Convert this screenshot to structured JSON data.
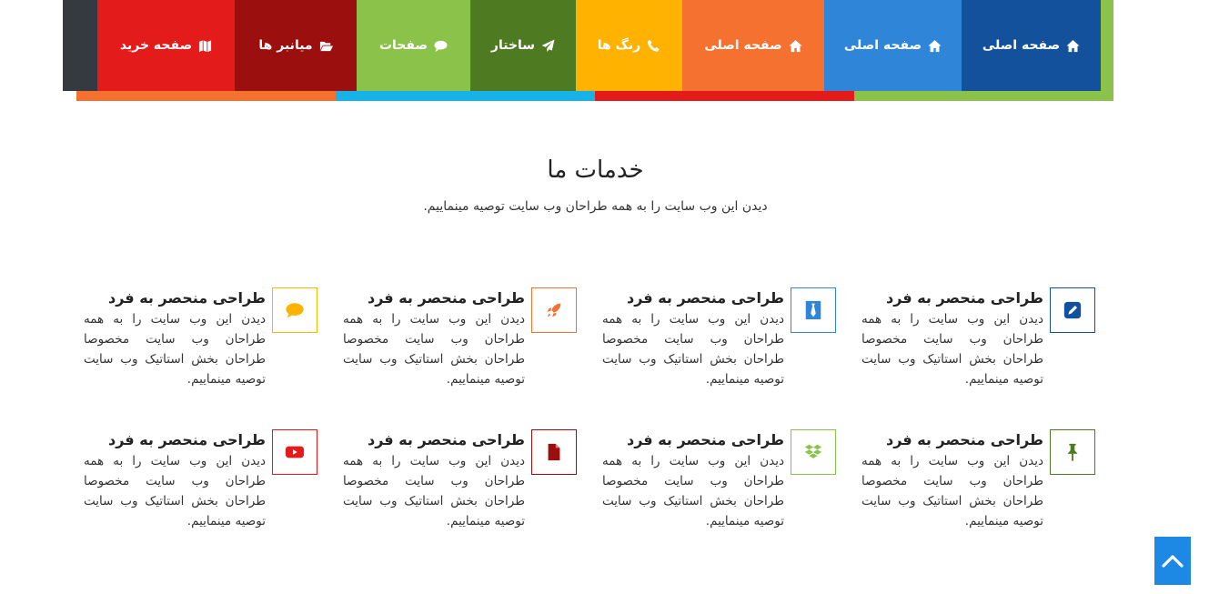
{
  "nav": {
    "items": [
      {
        "label": "صفحه خرید",
        "icon": "map-icon",
        "color": "#e31b1b",
        "width": 151
      },
      {
        "label": "میانبر ها",
        "icon": "folder-open-icon",
        "color": "#9b0f0f",
        "width": 134
      },
      {
        "label": "صفحات",
        "icon": "comment-icon",
        "color": "#8bc34a",
        "width": 125
      },
      {
        "label": "ساختار",
        "icon": "paper-plane-icon",
        "color": "#4e7a22",
        "width": 116
      },
      {
        "label": "رنگ ها",
        "icon": "phone-icon",
        "color": "#ffb300",
        "width": 117
      },
      {
        "label": "صفحه اصلی",
        "icon": "home-icon",
        "color": "#f47130",
        "width": 156
      },
      {
        "label": "صفحه اصلی",
        "icon": "home-icon",
        "color": "#2f86d8",
        "width": 151
      },
      {
        "label": "صفحه اصلی",
        "icon": "home-icon",
        "color": "#13519c",
        "width": 153
      }
    ],
    "color_bar": [
      "#f47130",
      "#17b3e8",
      "#e31b1b",
      "#8bc34a"
    ]
  },
  "section": {
    "title": "خدمات ما",
    "subtitle": "دیدن این وب سایت را به همه طراحان وب سایت توصیه مینماییم."
  },
  "features": [
    {
      "title": "طراحی منحصر به فرد",
      "desc": "دیدن این وب سایت را به همه طراحان وب سایت مخصوصا طراحان بخش استاتیک وب سایت توصیه مینماییم.",
      "icon": "pencil-square-icon",
      "color": "#13519c"
    },
    {
      "title": "طراحی منحصر به فرد",
      "desc": "دیدن این وب سایت را به همه طراحان وب سایت مخصوصا طراحان بخش استاتیک وب سایت توصیه مینماییم.",
      "icon": "tie-icon",
      "color": "#2f86d8"
    },
    {
      "title": "طراحی منحصر به فرد",
      "desc": "دیدن این وب سایت را به همه طراحان وب سایت مخصوصا طراحان بخش استاتیک وب سایت توصیه مینماییم.",
      "icon": "rocket-icon",
      "color": "#f47130"
    },
    {
      "title": "طراحی منحصر به فرد",
      "desc": "دیدن این وب سایت را به همه طراحان وب سایت مخصوصا طراحان بخش استاتیک وب سایت توصیه مینماییم.",
      "icon": "comment-icon",
      "color": "#ffb300"
    },
    {
      "title": "طراحی منحصر به فرد",
      "desc": "دیدن این وب سایت را به همه طراحان وب سایت مخصوصا طراحان بخش استاتیک وب سایت توصیه مینماییم.",
      "icon": "thumb-tack-icon",
      "color": "#4e7a22"
    },
    {
      "title": "طراحی منحصر به فرد",
      "desc": "دیدن این وب سایت را به همه طراحان وب سایت مخصوصا طراحان بخش استاتیک وب سایت توصیه مینماییم.",
      "icon": "dropbox-icon",
      "color": "#8bc34a"
    },
    {
      "title": "طراحی منحصر به فرد",
      "desc": "دیدن این وب سایت را به همه طراحان وب سایت مخصوصا طراحان بخش استاتیک وب سایت توصیه مینماییم.",
      "icon": "file-icon",
      "color": "#9b0f0f"
    },
    {
      "title": "طراحی منحصر به فرد",
      "desc": "دیدن این وب سایت را به همه طراحان وب سایت مخصوصا طراحان بخش استاتیک وب سایت توصیه مینماییم.",
      "icon": "youtube-icon",
      "color": "#e31b1b"
    }
  ],
  "scroll_top": {
    "icon": "chevron-up-icon",
    "color": "#1e88e5"
  }
}
